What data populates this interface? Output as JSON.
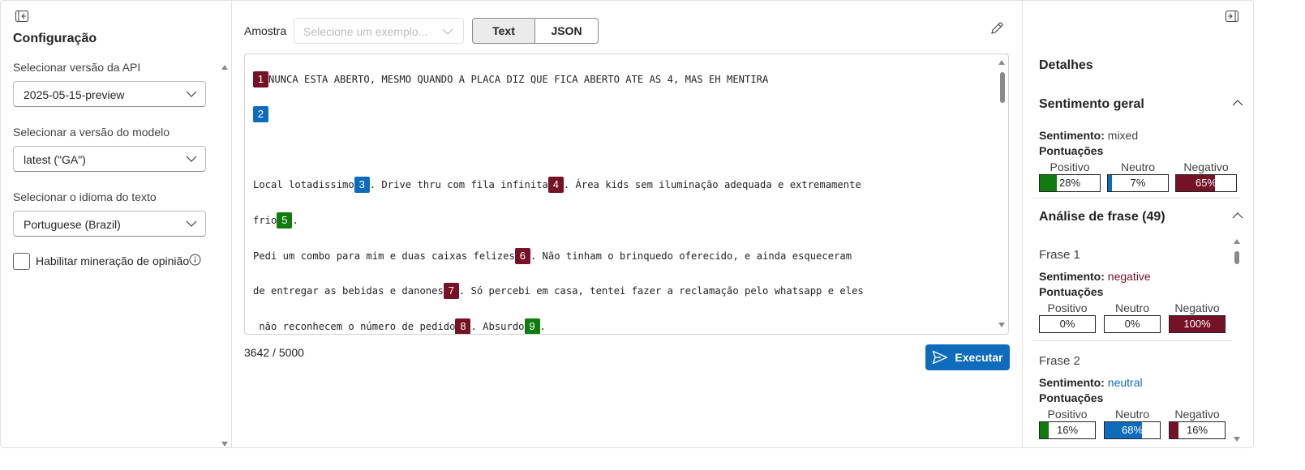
{
  "config": {
    "title": "Configuração",
    "api_version_label": "Selecionar versão da API",
    "api_version_value": "2025-05-15-preview",
    "model_version_label": "Selecionar a versão do modelo",
    "model_version_value": "latest (\"GA\")",
    "language_label": "Selecionar o idioma do texto",
    "language_value": "Portuguese (Brazil)",
    "opinion_mining_label": "Habilitar mineração de opinião",
    "opinion_mining_checked": false
  },
  "editor": {
    "sample_label": "Amostra",
    "sample_placeholder": "Selecione um exemplo...",
    "tabs": [
      {
        "label": "Text",
        "active": true
      },
      {
        "label": "JSON",
        "active": false
      }
    ],
    "lines": [
      {
        "segments": [
          {
            "badge": "1",
            "sentiment": "negative"
          },
          {
            "text": "NUNCA ESTA ABERTO, MESMO QUANDO A PLACA DIZ QUE FICA ABERTO ATE AS 4, MAS EH MENTIRA"
          }
        ]
      },
      {
        "segments": [
          {
            "badge": "2",
            "sentiment": "neutral"
          }
        ]
      },
      {
        "segments": [
          {
            "text": "Local lotadissimo"
          },
          {
            "badge": "3",
            "sentiment": "neutral"
          },
          {
            "text": ". Drive thru com fila infinita"
          },
          {
            "badge": "4",
            "sentiment": "negative"
          },
          {
            "text": ". Área kids sem iluminação adequada e extremamente"
          }
        ]
      },
      {
        "segments": [
          {
            "text": "frio"
          },
          {
            "badge": "5",
            "sentiment": "positive"
          },
          {
            "text": "."
          }
        ]
      },
      {
        "segments": [
          {
            "text": "Pedi um combo para mim e duas caixas felizes"
          },
          {
            "badge": "6",
            "sentiment": "negative"
          },
          {
            "text": ". Não tinham o brinquedo oferecido, e ainda esqueceram"
          }
        ]
      },
      {
        "segments": [
          {
            "text": "de entregar as bebidas e danones"
          },
          {
            "badge": "7",
            "sentiment": "negative"
          },
          {
            "text": ". Só percebi em casa, tentei fazer a reclamação pelo whatsapp e eles"
          }
        ]
      },
      {
        "segments": [
          {
            "text": " não reconhecem o número de pedido"
          },
          {
            "badge": "8",
            "sentiment": "negative"
          },
          {
            "text": ". Absurdo"
          },
          {
            "badge": "9",
            "sentiment": "positive"
          },
          {
            "text": "."
          }
        ]
      }
    ],
    "char_count": "3642 / 5000",
    "run_label": "Executar"
  },
  "details": {
    "title": "Detalhes",
    "overall": {
      "title": "Sentimento geral",
      "sentiment_label": "Sentimento:",
      "sentiment_value": "mixed",
      "scores_label": "Pontuações",
      "positive_label": "Positivo",
      "neutral_label": "Neutro",
      "negative_label": "Negativo",
      "positive": "28%",
      "neutral": "7%",
      "negative": "65%",
      "positive_fraction": 0.28,
      "neutral_fraction": 0.07,
      "negative_fraction": 0.65
    },
    "sentence_analysis_title": "Análise de frase (49)",
    "sentences": [
      {
        "title": "Frase 1",
        "sentiment_label": "Sentimento:",
        "sentiment_value": "negative",
        "scores_label": "Pontuações",
        "positive_label": "Positivo",
        "neutral_label": "Neutro",
        "negative_label": "Negativo",
        "positive": "0%",
        "neutral": "0%",
        "negative": "100%",
        "positive_fraction": 0.0,
        "neutral_fraction": 0.0,
        "negative_fraction": 1.0
      },
      {
        "title": "Frase 2",
        "sentiment_label": "Sentimento:",
        "sentiment_value": "neutral",
        "scores_label": "Pontuações",
        "positive_label": "Positivo",
        "neutral_label": "Neutro",
        "negative_label": "Negativo",
        "positive": "16%",
        "neutral": "68%",
        "negative": "16%",
        "positive_fraction": 0.16,
        "neutral_fraction": 0.68,
        "negative_fraction": 0.16
      }
    ]
  },
  "colors": {
    "positive": "#107c10",
    "neutral": "#0f6cbd",
    "negative": "#751225",
    "accent": "#0f6cbd"
  },
  "icons": {
    "panel_collapse": "panel-collapse-icon",
    "panel_expand": "panel-expand-icon",
    "edit": "pencil-icon",
    "run": "send-icon",
    "info": "info-icon",
    "chevron": "chevron-down-icon"
  }
}
